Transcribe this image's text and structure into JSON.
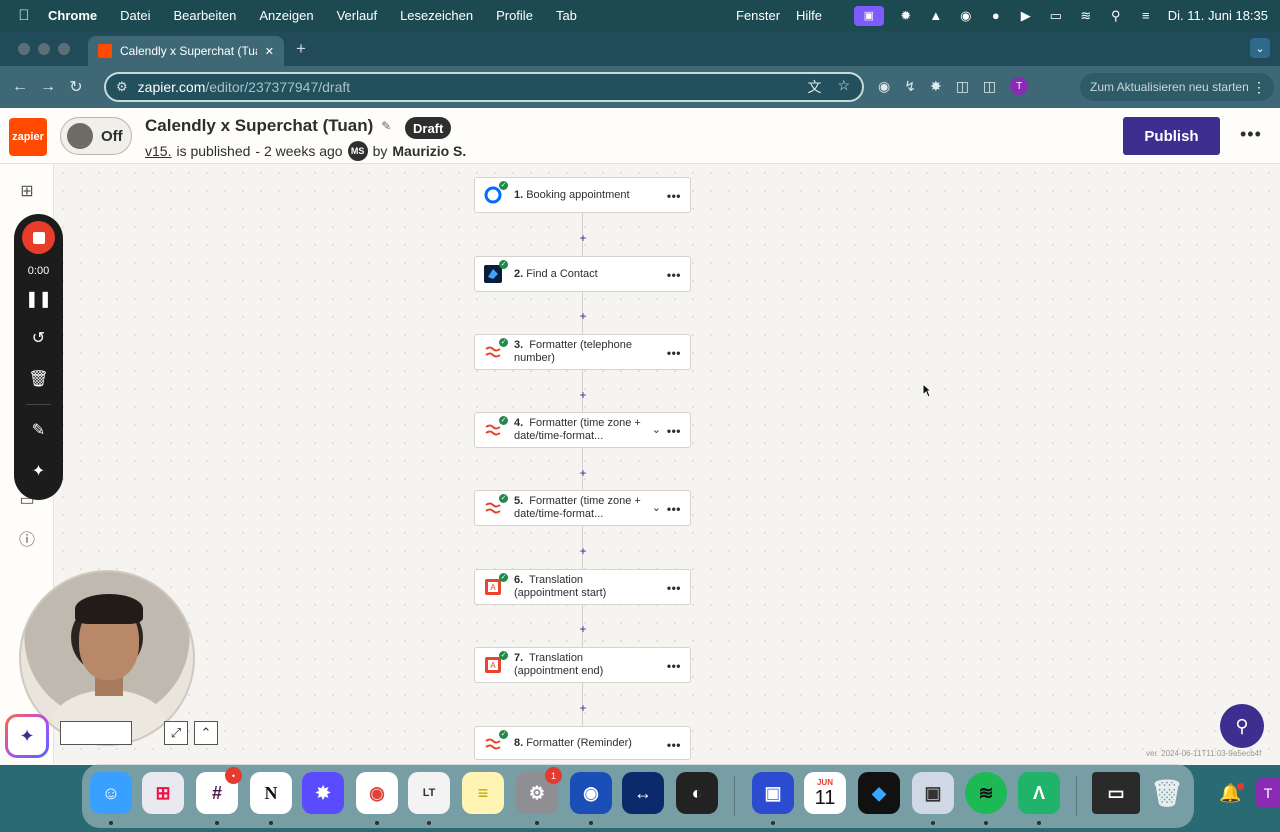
{
  "menubar": {
    "app": "Chrome",
    "items": [
      "Datei",
      "Bearbeiten",
      "Anzeigen",
      "Verlauf",
      "Lesezeichen",
      "Profile",
      "Tab"
    ],
    "right_items": [
      "Fenster",
      "Hilfe"
    ],
    "datetime": "Di. 11. Juni  18:35"
  },
  "browser": {
    "tab_title": "Calendly x Superchat (Tuan) | Zapier",
    "url_domain": "zapier.com",
    "url_path": "/editor/237377947/draft",
    "profile_initial": "T",
    "update_label": "Zum Aktualisieren neu starten"
  },
  "zap": {
    "logo_text": "zapier",
    "toggle_label": "Off",
    "title": "Calendly x Superchat (Tuan)",
    "status_badge": "Draft",
    "version_link": "v15.",
    "published_text": "is published",
    "time_ago": "- 2 weeks ago",
    "author_initials": "MS",
    "by_label": "by",
    "author": "Maurizio S.",
    "publish_label": "Publish",
    "more_label": "•••"
  },
  "steps": [
    {
      "num": "1.",
      "label": "Booking appointment",
      "icon": "calendly-icon"
    },
    {
      "num": "2.",
      "label": "Find a Contact",
      "icon": "superchat-icon"
    },
    {
      "num": "3.",
      "label": "Formatter (telephone number)",
      "icon": "formatter-icon"
    },
    {
      "num": "4.",
      "label": "Formatter (time zone + date/time-format...",
      "icon": "formatter-icon"
    },
    {
      "num": "5.",
      "label": "Formatter (time zone + date/time-format...",
      "icon": "formatter-icon"
    },
    {
      "num": "6.",
      "label": "Translation (appointment start)",
      "icon": "translation-icon"
    },
    {
      "num": "7.",
      "label": "Translation (appointment end)",
      "icon": "translation-icon"
    },
    {
      "num": "8.",
      "label": "Formatter (Reminder)",
      "icon": "formatter-icon"
    }
  ],
  "recorder": {
    "time": "0:00"
  },
  "version_text": "ver. 2024-06-11T11:03-9a5ecb4f",
  "dock": {
    "calendar_month": "JUN",
    "calendar_day": "11",
    "slack_badge": "•",
    "settings_badge": "1"
  }
}
